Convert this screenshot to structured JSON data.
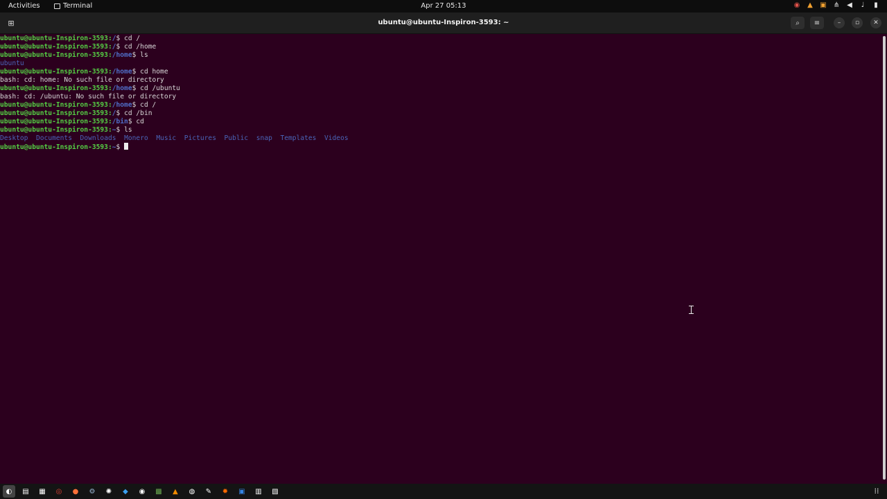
{
  "topbar": {
    "activities": "Activities",
    "app_name": "Terminal",
    "clock": "Apr 27  05:13",
    "tray_icons": [
      "update-icon",
      "vlc-icon",
      "package-icon",
      "network-icon",
      "volume-icon",
      "microphone-icon",
      "battery-icon"
    ]
  },
  "window": {
    "title": "ubuntu@ubuntu-Inspiron-3593: ~",
    "buttons": [
      "search-icon",
      "menu-icon",
      "minimize-icon",
      "maximize-icon",
      "close-icon"
    ]
  },
  "terminal": {
    "lines": [
      {
        "user": "ubuntu@ubuntu-Inspiron-3593:",
        "path": "/",
        "cmd": "$ cd /"
      },
      {
        "user": "ubuntu@ubuntu-Inspiron-3593:",
        "path": "/",
        "cmd": "$ cd /home"
      },
      {
        "user": "ubuntu@ubuntu-Inspiron-3593:",
        "path": "/home",
        "cmd": "$ ls"
      },
      {
        "dirs": [
          "ubuntu"
        ]
      },
      {
        "user": "ubuntu@ubuntu-Inspiron-3593:",
        "path": "/home",
        "cmd": "$ cd home"
      },
      {
        "out": "bash: cd: home: No such file or directory"
      },
      {
        "user": "ubuntu@ubuntu-Inspiron-3593:",
        "path": "/home",
        "cmd": "$ cd /ubuntu"
      },
      {
        "out": "bash: cd: /ubuntu: No such file or directory"
      },
      {
        "user": "ubuntu@ubuntu-Inspiron-3593:",
        "path": "/home",
        "cmd": "$ cd /"
      },
      {
        "user": "ubuntu@ubuntu-Inspiron-3593:",
        "path": "/",
        "cmd": "$ cd /bin"
      },
      {
        "user": "ubuntu@ubuntu-Inspiron-3593:",
        "path": "/bin",
        "cmd": "$ cd"
      },
      {
        "user": "ubuntu@ubuntu-Inspiron-3593:",
        "path": "~",
        "cmd": "$ ls"
      },
      {
        "dirs": [
          "Desktop",
          "Documents",
          "Downloads",
          "Monero",
          "Music",
          "Pictures",
          "Public",
          "snap",
          "Templates",
          "Videos"
        ]
      },
      {
        "user": "ubuntu@ubuntu-Inspiron-3593:",
        "path": "~",
        "cmd": "$ ",
        "cursor": true
      }
    ]
  },
  "dock": {
    "apps": [
      "show-apps-icon",
      "files-icon",
      "text-editor-icon",
      "chrome-icon",
      "firefox-icon",
      "steam-icon",
      "settings-icon",
      "vscode-icon",
      "obs-icon",
      "minecraft-icon",
      "vlc-icon",
      "software-icon",
      "tool-icon",
      "game-icon",
      "calendar-icon",
      "notes-icon",
      "document-icon"
    ],
    "show_apps": "app-grid-icon"
  }
}
